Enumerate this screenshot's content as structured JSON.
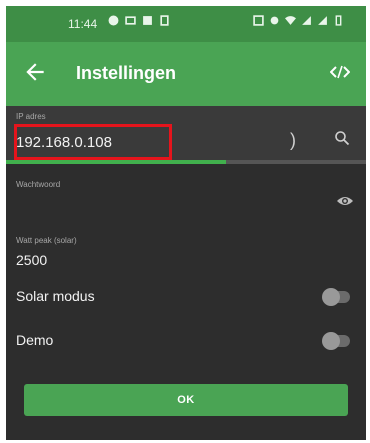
{
  "status_bar": {
    "time": "11:44"
  },
  "app_bar": {
    "title": "Instellingen"
  },
  "fields": {
    "ip": {
      "label": "IP adres",
      "value": "192.168.0.108",
      "progress": 0.61
    },
    "password": {
      "label": "Wachtwoord",
      "value": ""
    },
    "watt_peak": {
      "label": "Watt peak (solar)",
      "value": "2500"
    }
  },
  "toggles": {
    "solar": {
      "label": "Solar modus",
      "on": false
    },
    "demo": {
      "label": "Demo",
      "on": false
    }
  },
  "ok_button": {
    "label": "OK"
  },
  "colors": {
    "primary": "#4aa454",
    "status_bar": "#3e8e46",
    "highlight": "#e5141c",
    "background": "#2d2d2d"
  },
  "icons": [
    "back-arrow-icon",
    "code-icon",
    "search-icon",
    "eye-icon"
  ]
}
